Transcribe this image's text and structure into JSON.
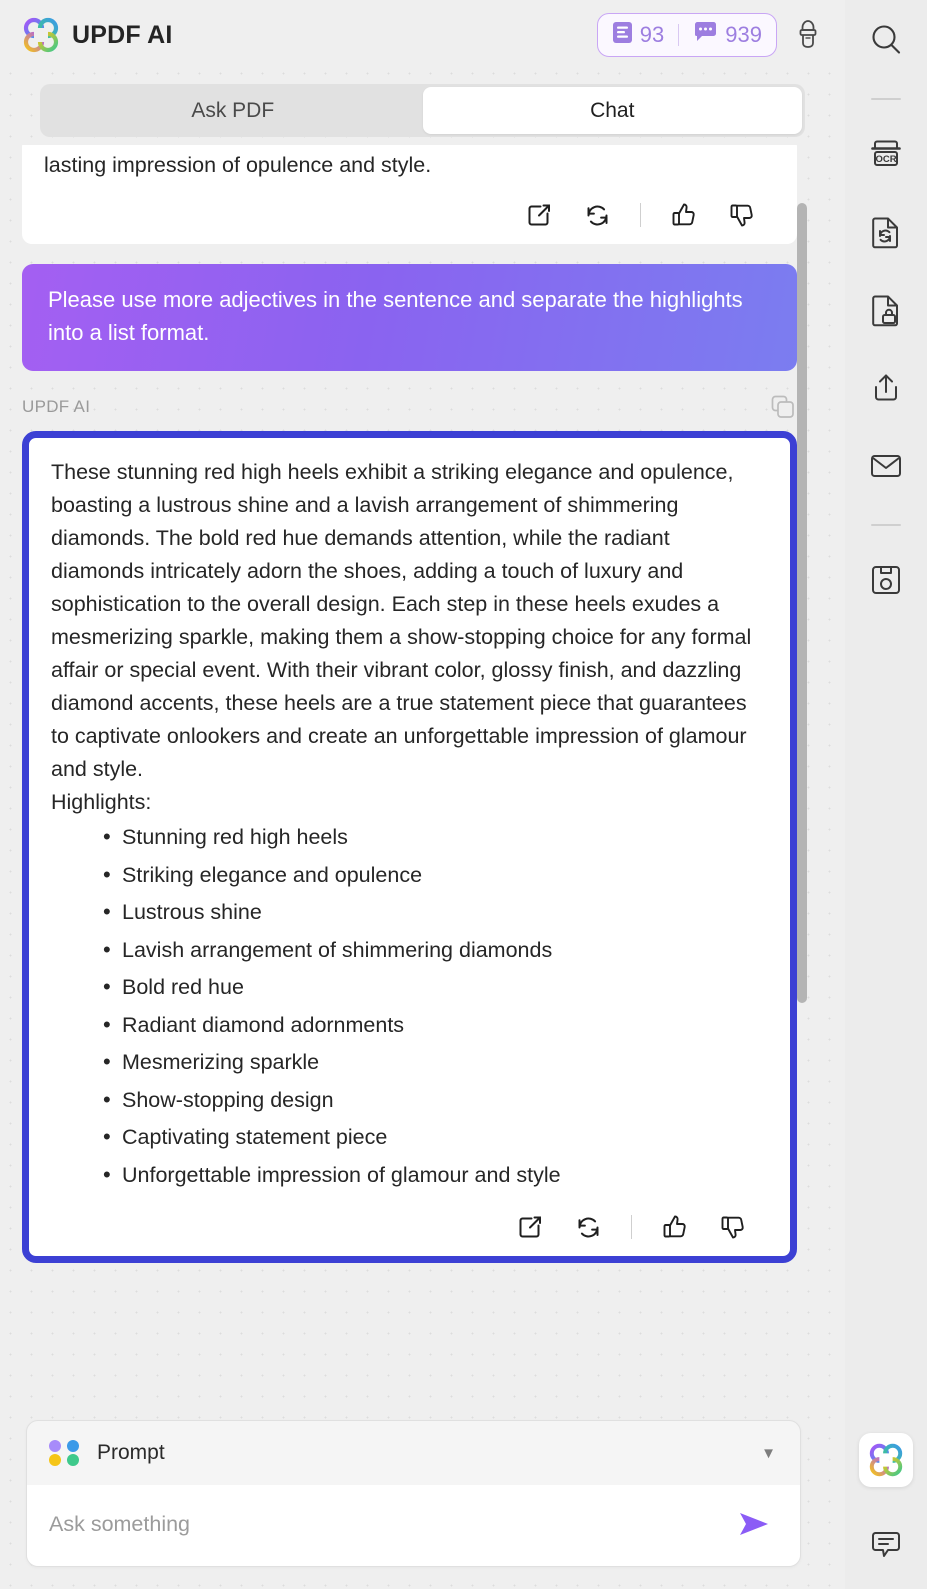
{
  "header": {
    "brand": "UPDF AI",
    "logo_icon": "clover-logo-icon",
    "credits": {
      "doc_icon": "document-credit-icon",
      "doc_count": "93",
      "chat_icon": "chat-credit-icon",
      "chat_count": "939"
    },
    "brush_icon": "brush-icon"
  },
  "tabs": [
    {
      "label": "Ask PDF",
      "active": false
    },
    {
      "label": "Chat",
      "active": true
    }
  ],
  "messages": {
    "previous_assistant_tail": "lasting impression of opulence and style.",
    "user_message": "Please use more adjectives in the sentence and separate the highlights into a list format.",
    "assistant_label": "UPDF AI",
    "assistant_body": "These stunning red high heels exhibit a striking elegance and opulence, boasting a lustrous shine and a lavish arrangement of shimmering diamonds. The bold red hue demands attention, while the radiant diamonds intricately adorn the shoes, adding a touch of luxury and sophistication to the overall design. Each step in these heels exudes a mesmerizing sparkle, making them a show-stopping choice for any formal affair or special event. With their vibrant color, glossy finish, and dazzling diamond accents, these heels are a true statement piece that guarantees to captivate onlookers and create an unforgettable impression of glamour and style.",
    "highlights_label": "Highlights:",
    "highlights": [
      "Stunning red high heels",
      "Striking elegance and opulence",
      "Lustrous shine",
      "Lavish arrangement of shimmering diamonds",
      "Bold red hue",
      "Radiant diamond adornments",
      "Mesmerizing sparkle",
      "Show-stopping design",
      "Captivating statement piece",
      "Unforgettable impression of glamour and style"
    ]
  },
  "message_actions": {
    "export_icon": "export-icon",
    "regenerate_icon": "regenerate-icon",
    "thumbs_up_icon": "thumbs-up-icon",
    "thumbs_down_icon": "thumbs-down-icon",
    "copy_icon": "copy-icon"
  },
  "composer": {
    "prompt_label": "Prompt",
    "prompt_dots_icon": "four-dots-icon",
    "caret_icon": "chevron-down-icon",
    "input_value": "",
    "input_placeholder": "Ask something",
    "send_icon": "send-icon"
  },
  "rail": {
    "items": [
      {
        "name": "search-icon"
      },
      {
        "name": "ocr-icon"
      },
      {
        "name": "convert-file-icon"
      },
      {
        "name": "protect-file-icon"
      },
      {
        "name": "share-icon"
      },
      {
        "name": "email-icon"
      },
      {
        "name": "save-icon"
      }
    ],
    "bottom": [
      {
        "name": "updf-ai-logo-button"
      },
      {
        "name": "comment-icon"
      }
    ]
  },
  "colors": {
    "accent_blue": "#3c40d4",
    "accent_purple": "#8b5cf6",
    "credit_purple": "#9d7ee0",
    "bubble_from": "#a45ff2",
    "bubble_to": "#7b7df0",
    "page_bg": "#efefef"
  }
}
